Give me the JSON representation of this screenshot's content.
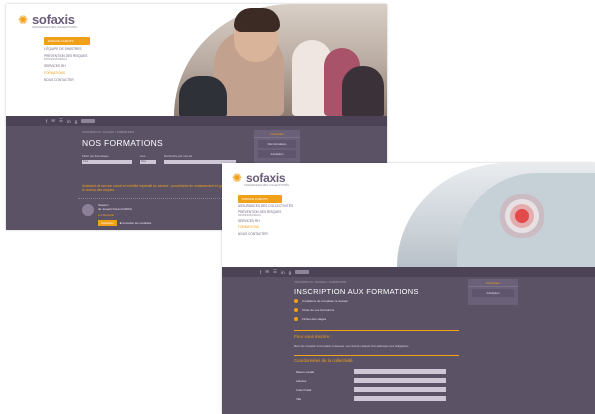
{
  "brand": {
    "name": "sofaxis",
    "tagline": "ASSURANCES DES COLLECTIVITÉS",
    "accent": "#f0a019",
    "panel": "#5b5266"
  },
  "social_icons": [
    "facebook-icon",
    "twitter-icon",
    "rss-icon",
    "linkedin-icon",
    "google-icon"
  ],
  "shot1": {
    "cta": "ESPACE CLIENTS",
    "nav": [
      {
        "label": "L'ÉQUIPE DE SINISTRES",
        "sub": ""
      },
      {
        "label": "PRÉVENTION DES RISQUES",
        "sub": "PROFESSIONNELS"
      },
      {
        "label": "SERVICES RH",
        "sub": ""
      },
      {
        "label": "FORMATIONS",
        "sub": ""
      },
      {
        "label": "NOUS CONTACTER",
        "sub": ""
      }
    ],
    "crumb": "VOUS ÊTES ICI : ACCUEIL > FORMATIONS",
    "title": "NOS FORMATIONS",
    "side": {
      "title": "Inscription",
      "items": [
        "Nos formations",
        "Inscription"
      ]
    },
    "filters": [
      {
        "label": "Filtrer par thématique",
        "value": "Tous"
      },
      {
        "label": "Lieu",
        "value": "Tous"
      },
      {
        "label": "Recherche par mot-clé",
        "value": ""
      }
    ],
    "alert": "Assistant de service social et mobilité impératif au service : procédures du reclassement et gestion sociale dans le champ des risques.",
    "course": {
      "date": "Session",
      "title": "de Joseph Durand (RRH)",
      "location": "à Marseille",
      "button": "Inscription",
      "link": "Consulter les modalités"
    }
  },
  "shot2": {
    "cta": "ESPACE CLIENTS",
    "nav": [
      {
        "label": "ASSURANCES DES COLLECTIVITÉS",
        "sub": ""
      },
      {
        "label": "PRÉVENTION DES RISQUES",
        "sub": "PROFESSIONNELS"
      },
      {
        "label": "SERVICES RH",
        "sub": ""
      },
      {
        "label": "FORMATIONS",
        "sub": ""
      },
      {
        "label": "NOUS CONTACTER",
        "sub": ""
      }
    ],
    "crumb": "VOUS ÊTES ICI : ACCUEIL > FORMATIONS",
    "title": "INSCRIPTION AUX FORMATIONS",
    "side": {
      "title": "Inscription",
      "items": [
        "Inscription"
      ]
    },
    "steps": [
      "Conditions de compléter le dossier",
      "Choix de vos formations",
      "Fiches des stages"
    ],
    "section1": "Pour vous inscrire :",
    "para": "Merci de compléter le formulaire ci-dessous. Les champs marqués d'un astérisque sont obligatoires.",
    "section2": "Coordonnées de la collectivité",
    "fields": [
      "Raison sociale",
      "Adresse",
      "Code Postal",
      "Ville"
    ]
  }
}
